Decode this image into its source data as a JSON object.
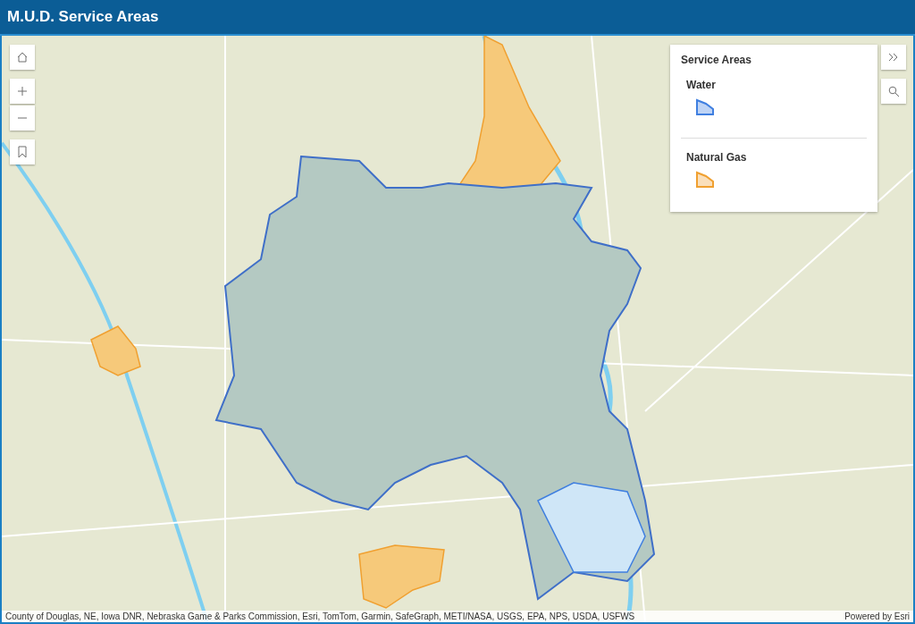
{
  "header": {
    "title": "M.U.D. Service Areas"
  },
  "legend": {
    "title": "Service Areas",
    "layers": [
      {
        "label": "Water",
        "color": "#3f7fe0"
      },
      {
        "label": "Natural Gas",
        "color": "#f0a030"
      }
    ]
  },
  "attribution": {
    "sources": "County of Douglas, NE, Iowa DNR, Nebraska Game & Parks Commission, Esri, TomTom, Garmin, SafeGraph, METI/NASA, USGS, EPA, NPS, USDA, USFWS",
    "powered_by": "Powered by Esri"
  }
}
